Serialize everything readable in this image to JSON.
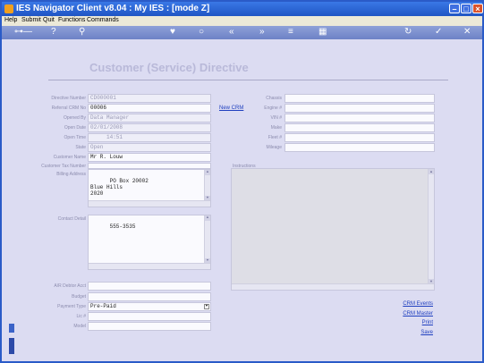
{
  "window": {
    "title": "IES Navigator Client v8.04 : My IES :      [mode Z]"
  },
  "menu": [
    "Help",
    "Submit",
    "Quit",
    "Functions",
    "Commands"
  ],
  "toolbar_icons": [
    "key-icon",
    "help-icon",
    "search-icon",
    "heart-icon",
    "circle-icon",
    "double-left-icon",
    "double-right-icon",
    "list-icon",
    "grid-icon",
    "refresh-icon",
    "check-icon",
    "close-icon"
  ],
  "form": {
    "heading": "Customer (Service) Directive",
    "labels": {
      "directive_number": "Directive Number",
      "referral_crm": "Referral CRM No",
      "opened_by": "Opened By",
      "open_date": "Open Date",
      "open_time": "Open Time",
      "state": "State",
      "customer_name": "Customer Name",
      "customer_tax_number": "Customer Tax Number",
      "billing_address": "Billing Address",
      "contact_detail": "Contact Detail",
      "ar_debtor_acct": "A/R Debtor Acct",
      "budget": "Budget",
      "payment_type": "Payment Type",
      "lic": "Lic #",
      "model": "Model",
      "chassis": "Chassis",
      "engine": "Engine #",
      "vin": "VIN #",
      "make": "Make",
      "fleet": "Fleet #",
      "mileage": "Mileage",
      "instructions": "Instructions"
    },
    "values": {
      "directive_number": "CD000001",
      "referral_crm": "00006",
      "opened_by": "Data Manager",
      "open_date": "02/01/2008",
      "open_time": "14:51",
      "state": "Open",
      "customer_name": "Mr R. Louw",
      "billing_address": "PO Box 20002\nBlue Hills\n2020",
      "contact_detail": "555-3535",
      "payment_type": "Pre-Paid"
    },
    "links": {
      "new_crm": "New CRM",
      "crm_events": "CRM Events",
      "crm_master": "CRM Master",
      "print": "Print",
      "save": "Save"
    }
  }
}
